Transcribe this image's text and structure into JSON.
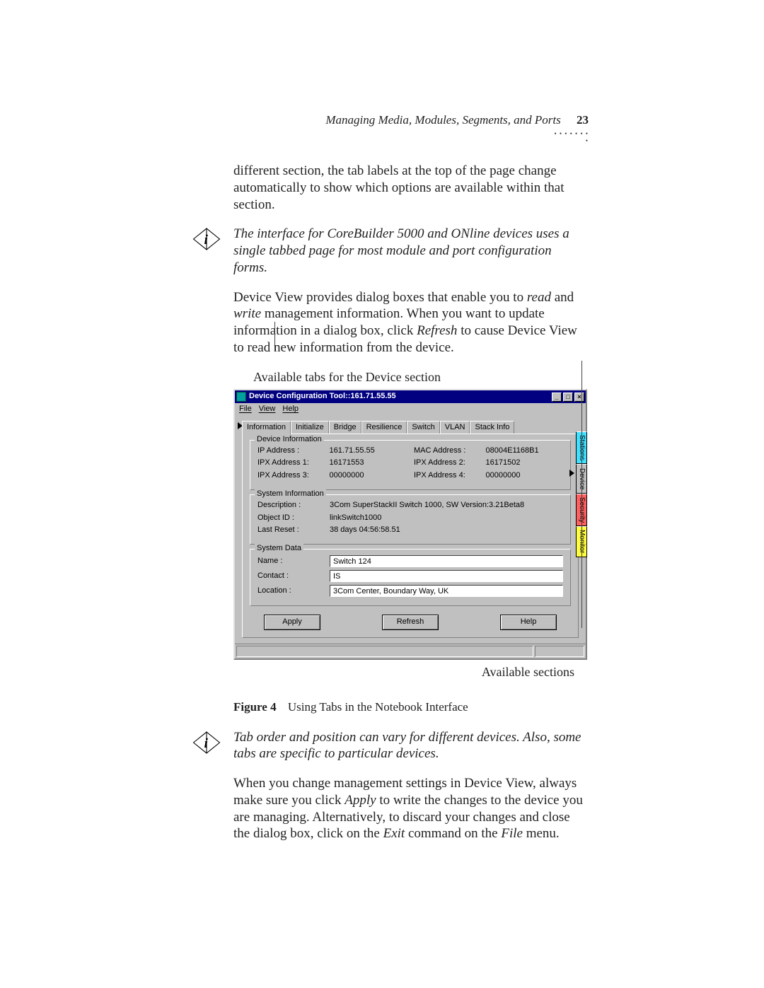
{
  "header": {
    "running": "Managing Media, Modules, Segments, and Ports",
    "page": "23"
  },
  "paras": {
    "p1": "different section, the tab labels at the top of the page change automatically to show which options are available within that section.",
    "note1": "The interface for CoreBuilder 5000 and ONline devices uses a single tabbed page for most module and port configuration forms.",
    "p2a": "Device View provides dialog boxes that enable you to ",
    "p2_read": "read",
    "p2b": " and ",
    "p2_write": "write",
    "p2c": " management information. When you want to update information in a dialog box, click ",
    "p2_refresh": "Refresh",
    "p2d": " to cause Device View to read new information from the device.",
    "caption_above": "Available tabs for the Device section",
    "sections_label": "Available sections",
    "fig_num": "Figure 4",
    "fig_title": "Using Tabs in the Notebook Interface",
    "note2": "Tab order and position can vary for different devices. Also, some tabs are specific to particular devices.",
    "p3a": "When you change management settings in Device View, always make sure you click ",
    "p3_apply": "Apply",
    "p3b": " to write the changes to the device you are managing. Alternatively, to discard your changes and close the dialog box, click on the ",
    "p3_exit": "Exit",
    "p3c": " command on the ",
    "p3_file": "File",
    "p3d": " menu."
  },
  "dialog": {
    "title": "Device Configuration Tool::161.71.55.55",
    "menu_file": "File",
    "menu_view": "View",
    "menu_help": "Help",
    "tabs": [
      "Information",
      "Initialize",
      "Bridge",
      "Resilience",
      "Switch",
      "VLAN",
      "Stack Info"
    ],
    "side_tabs": [
      "Stations",
      "Device",
      "Security",
      "Monitor"
    ],
    "group_devinfo": "Device Information",
    "ip_label": "IP Address :",
    "ip_val": "161.71.55.55",
    "mac_label": "MAC Address :",
    "mac_val": "08004E1168B1",
    "ipx1_label": "IPX Address 1:",
    "ipx1_val": "16171553",
    "ipx2_label": "IPX Address 2:",
    "ipx2_val": "16171502",
    "ipx3_label": "IPX Address 3:",
    "ipx3_val": "00000000",
    "ipx4_label": "IPX Address 4:",
    "ipx4_val": "00000000",
    "group_sysinfo": "System Information",
    "desc_label": "Description :",
    "desc_val": "3Com SuperStackII Switch 1000, SW Version:3.21Beta8",
    "obj_label": "Object ID :",
    "obj_val": "linkSwitch1000",
    "reset_label": "Last Reset :",
    "reset_val": "38 days 04:56:58.51",
    "group_sysdata": "System Data",
    "name_label": "Name :",
    "name_val": "Switch 124",
    "contact_label": "Contact :",
    "contact_val": "IS",
    "location_label": "Location :",
    "location_val": "3Com Center, Boundary Way, UK",
    "btn_apply": "Apply",
    "btn_refresh": "Refresh",
    "btn_help": "Help"
  }
}
